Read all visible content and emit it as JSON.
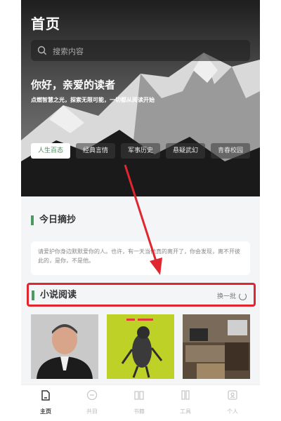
{
  "header": {
    "title": "首页"
  },
  "search": {
    "placeholder": "搜索内容"
  },
  "hero": {
    "greeting": "你好，亲爱的读者",
    "subtitle": "点燃智慧之光，探索无限可能，一切都从阅读开始"
  },
  "categories": [
    {
      "label": "人生百态",
      "active": true
    },
    {
      "label": "经典言情",
      "active": false
    },
    {
      "label": "军事历史",
      "active": false
    },
    {
      "label": "悬疑武幻",
      "active": false
    },
    {
      "label": "青春校园",
      "active": false
    }
  ],
  "daily": {
    "title": "今日摘抄",
    "quote": "请爱护你身边默默爱你的人。也许，有一天当他真的离开了，你会发现，离不开彼此的，是你，不是他。"
  },
  "novels": {
    "title": "小说阅读",
    "refresh_label": "换一批"
  },
  "tabbar": [
    {
      "label": "主页",
      "icon": "home-icon",
      "active": true
    },
    {
      "label": "共目",
      "icon": "chat-icon",
      "active": false
    },
    {
      "label": "书籍",
      "icon": "book-icon",
      "active": false
    },
    {
      "label": "工具",
      "icon": "tool-icon",
      "active": false
    },
    {
      "label": "个人",
      "icon": "person-icon",
      "active": false
    }
  ],
  "colors": {
    "accent": "#4c9a61",
    "highlight_border": "#e0262f"
  }
}
